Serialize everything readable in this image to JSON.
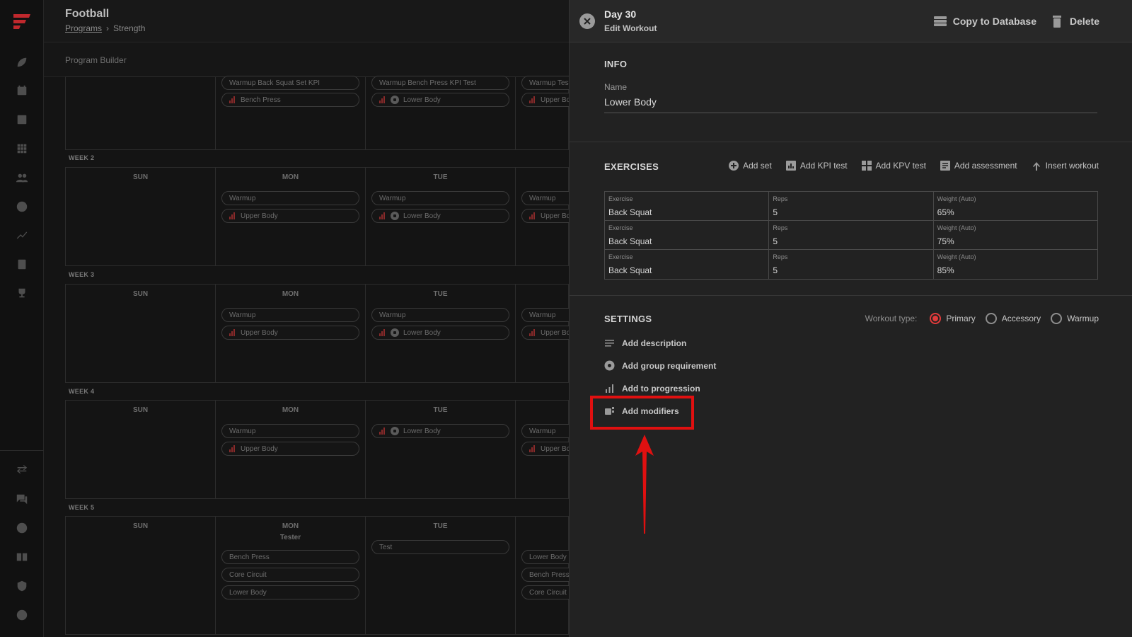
{
  "app": {
    "title": "Football",
    "breadcrumb": [
      "Programs",
      "Strength"
    ],
    "subtitle": "Program Builder"
  },
  "rail_icons": [
    "logo-icon",
    "football-icon",
    "calendar-icon",
    "notes-icon",
    "grid-icon",
    "people-icon",
    "ball-icon",
    "trend-icon",
    "clipboard-icon",
    "trophy-icon",
    "swap-icon",
    "chat-icon",
    "help-icon",
    "library-icon",
    "shield-icon",
    "account-icon"
  ],
  "weeks": {
    "w1": {
      "mon": [
        "Warmup Back Squat Set KPI",
        "Bench Press"
      ],
      "tue": [
        "Warmup Bench Press KPI Test",
        "Lower Body"
      ],
      "wed": [
        "Warmup Test",
        "Upper Bo"
      ]
    },
    "w2": {
      "label": "WEEK 2",
      "days": [
        "SUN",
        "MON",
        "TUE"
      ],
      "mon": [
        "Warmup",
        "Upper Body"
      ],
      "tue": [
        "Warmup",
        "Lower Body"
      ],
      "wed": [
        "Warmup",
        "Upper Bo"
      ]
    },
    "w3": {
      "label": "WEEK 3",
      "days": [
        "SUN",
        "MON",
        "TUE"
      ],
      "mon": [
        "Warmup",
        "Upper Body"
      ],
      "tue": [
        "Warmup",
        "Lower Body"
      ],
      "wed": [
        "Warmup",
        "Upper Bo"
      ]
    },
    "w4": {
      "label": "WEEK 4",
      "days": [
        "SUN",
        "MON",
        "TUE"
      ],
      "mon": [
        "Warmup",
        "Upper Body"
      ],
      "tue": [
        "Lower Body"
      ],
      "wed": [
        "Warmup",
        "Upper Bo"
      ]
    },
    "w5": {
      "label": "WEEK 5",
      "days": [
        "SUN",
        "MON",
        "TUE"
      ],
      "mon_sub": "Tester",
      "mon": [
        "Bench Press",
        "Core Circuit",
        "Lower Body"
      ],
      "tue": [
        "Test"
      ],
      "wed": [
        "Lower Body",
        "Bench Press",
        "Core Circuit"
      ]
    }
  },
  "drawer": {
    "day": "Day 30",
    "subtitle": "Edit Workout",
    "copy_label": "Copy to Database",
    "delete_label": "Delete",
    "info_title": "INFO",
    "name_label": "Name",
    "name_value": "Lower Body",
    "exercises_title": "EXERCISES",
    "actions": [
      "Add set",
      "Add KPI test",
      "Add KPV test",
      "Add assessment",
      "Insert workout"
    ],
    "table": [
      {
        "exercise": "Back Squat",
        "reps": "5",
        "weight": "65%"
      },
      {
        "exercise": "Back Squat",
        "reps": "5",
        "weight": "75%"
      },
      {
        "exercise": "Back Squat",
        "reps": "5",
        "weight": "85%"
      }
    ],
    "col_exercise": "Exercise",
    "col_reps": "Reps",
    "col_weight": "Weight (Auto)",
    "settings_title": "SETTINGS",
    "workout_type_label": "Workout type:",
    "workout_types": [
      "Primary",
      "Accessory",
      "Warmup"
    ],
    "selected_type": "Primary",
    "settings_items": [
      "Add description",
      "Add group requirement",
      "Add to progression",
      "Add modifiers"
    ]
  },
  "colors": {
    "accent": "#e23b3b",
    "annotation": "#e01010"
  }
}
